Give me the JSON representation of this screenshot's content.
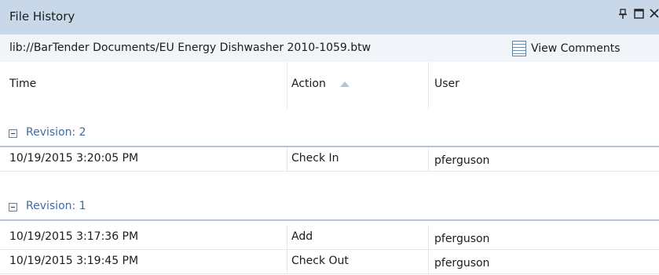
{
  "panel": {
    "title": "File History",
    "pin_icon": "pin-icon",
    "maximize_icon": "maximize-icon",
    "close_icon": "close-icon"
  },
  "pathbar": {
    "path": "lib://BarTender Documents/EU Energy Dishwasher 2010-1059.btw",
    "view_comments_label": "View Comments",
    "view_comments_icon": "notes-icon"
  },
  "columns": {
    "time": "Time",
    "action": "Action",
    "user": "User",
    "sort_icon": "sort-ascending-icon"
  },
  "groups": [
    {
      "label": "Revision: 2",
      "rows": [
        {
          "time": "10/19/2015 3:20:05 PM",
          "action": "Check In",
          "user": "pferguson"
        }
      ]
    },
    {
      "label": "Revision: 1",
      "rows": [
        {
          "time": "10/19/2015 3:17:36 PM",
          "action": "Add",
          "user": "pferguson"
        },
        {
          "time": "10/19/2015 3:19:45 PM",
          "action": "Check Out",
          "user": "pferguson"
        }
      ]
    }
  ],
  "colors": {
    "titlebar": "#c9d8e8",
    "group_label": "#3d6ca3"
  }
}
